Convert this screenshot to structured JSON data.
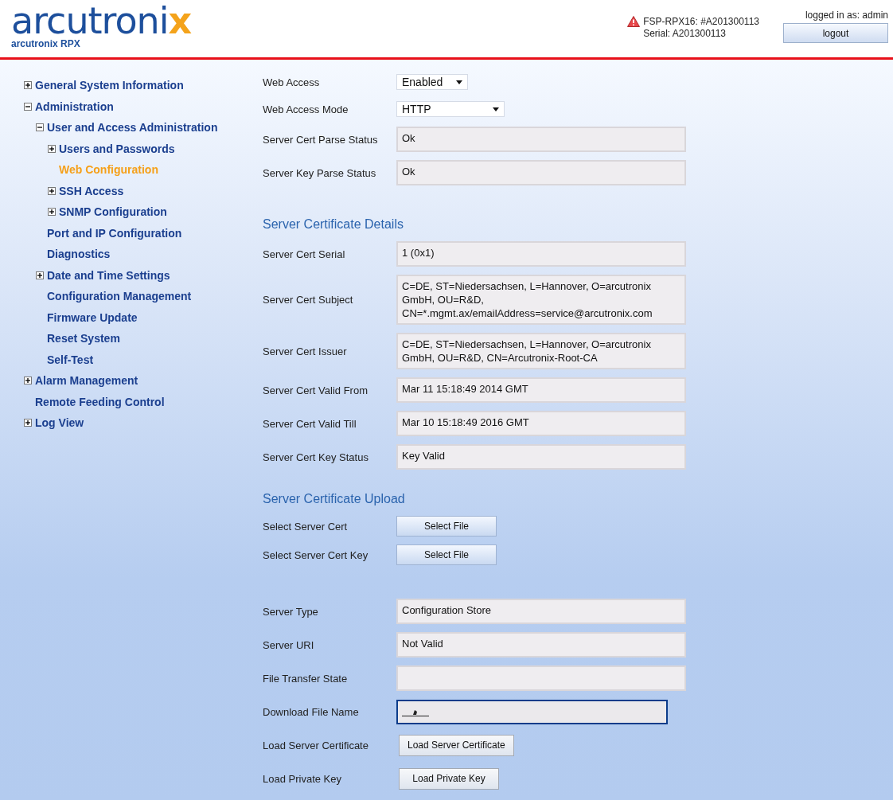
{
  "header": {
    "logo_main": "arcutroni",
    "logo_accent": "x",
    "logo_subtitle": "arcutronix RPX",
    "device": "FSP-RPX16: #A201300113",
    "serial": "Serial: A201300113",
    "alarm": true,
    "login": "logged in as: admin",
    "logout": "logout"
  },
  "sidebar": {
    "items": [
      {
        "label": "General System Information",
        "kind": "folder",
        "expanded": false,
        "selected": false
      },
      {
        "label": "Administration",
        "kind": "folder",
        "expanded": true,
        "selected": false,
        "children": [
          {
            "label": "User and Access Administration",
            "kind": "folder",
            "expanded": true,
            "selected": false,
            "children": [
              {
                "label": "Users and Passwords",
                "kind": "folder",
                "expanded": false,
                "selected": false
              },
              {
                "label": "Web Configuration",
                "kind": "page",
                "selected": true
              },
              {
                "label": "SSH Access",
                "kind": "folder",
                "expanded": false,
                "selected": false
              },
              {
                "label": "SNMP Configuration",
                "kind": "folder",
                "expanded": false,
                "selected": false
              }
            ]
          },
          {
            "label": "Port and IP Configuration",
            "kind": "page",
            "selected": false
          },
          {
            "label": "Diagnostics",
            "kind": "page",
            "selected": false
          },
          {
            "label": "Date and Time Settings",
            "kind": "folder",
            "expanded": false,
            "selected": false
          },
          {
            "label": "Configuration Management",
            "kind": "page",
            "selected": false
          },
          {
            "label": "Firmware Update",
            "kind": "page",
            "selected": false
          },
          {
            "label": "Reset System",
            "kind": "page",
            "selected": false
          },
          {
            "label": "Self-Test",
            "kind": "page",
            "selected": false
          }
        ]
      },
      {
        "label": "Alarm Management",
        "kind": "folder",
        "expanded": false,
        "selected": false
      },
      {
        "label": "Remote Feeding Control",
        "kind": "page",
        "selected": false
      },
      {
        "label": "Log View",
        "kind": "folder",
        "expanded": false,
        "selected": false
      }
    ]
  },
  "sections": [
    {
      "rows": [
        {
          "kind": "select",
          "label": "Web Access",
          "value": "Enabled"
        },
        {
          "kind": "select",
          "label": "Web Access Mode",
          "value": "HTTP"
        },
        {
          "kind": "readonly",
          "label": "Server Cert Parse Status",
          "value": "Ok"
        },
        {
          "kind": "readonly",
          "label": "Server Key Parse Status",
          "value": "Ok"
        }
      ]
    },
    {
      "heading": "Server Certificate Details",
      "rows": [
        {
          "kind": "readonly",
          "label": "Server Cert Serial",
          "value": "1 (0x1)"
        },
        {
          "kind": "readonly",
          "label": "Server Cert Subject",
          "value": "C=DE, ST=Niedersachsen, L=Hannover, O=arcutronix GmbH, OU=R&D, CN=*.mgmt.ax/emailAddress=service@arcutronix.com"
        },
        {
          "kind": "readonly",
          "label": "Server Cert Issuer",
          "value": "C=DE, ST=Niedersachsen, L=Hannover, O=arcutronix GmbH, OU=R&D, CN=Arcutronix-Root-CA"
        },
        {
          "kind": "readonly",
          "label": "Server Cert Valid From",
          "value": "Mar 11 15:18:49 2014 GMT"
        },
        {
          "kind": "readonly",
          "label": "Server Cert Valid Till",
          "value": "Mar 10 15:18:49 2016 GMT"
        },
        {
          "kind": "readonly",
          "label": "Server Cert Key Status",
          "value": "Key Valid"
        }
      ]
    },
    {
      "heading": "Server Certificate Upload",
      "rows": [
        {
          "kind": "file-button",
          "label": "Select Server Cert",
          "value": "Select File"
        },
        {
          "kind": "file-button",
          "label": "Select Server Cert Key",
          "value": "Select File"
        }
      ]
    },
    {
      "rows": [
        {
          "kind": "readonly",
          "label": "Server Type",
          "value": "Configuration Store"
        },
        {
          "kind": "readonly",
          "label": "Server URI",
          "value": "Not Valid"
        },
        {
          "kind": "readonly",
          "label": "File Transfer State"
        },
        {
          "kind": "input",
          "label": "Download File Name",
          "focused": true
        },
        {
          "kind": "button",
          "label": "Load Server Certificate",
          "value": "Load Server Certificate"
        },
        {
          "kind": "button",
          "label": "Load Private Key",
          "value": "Load Private Key"
        }
      ]
    }
  ]
}
